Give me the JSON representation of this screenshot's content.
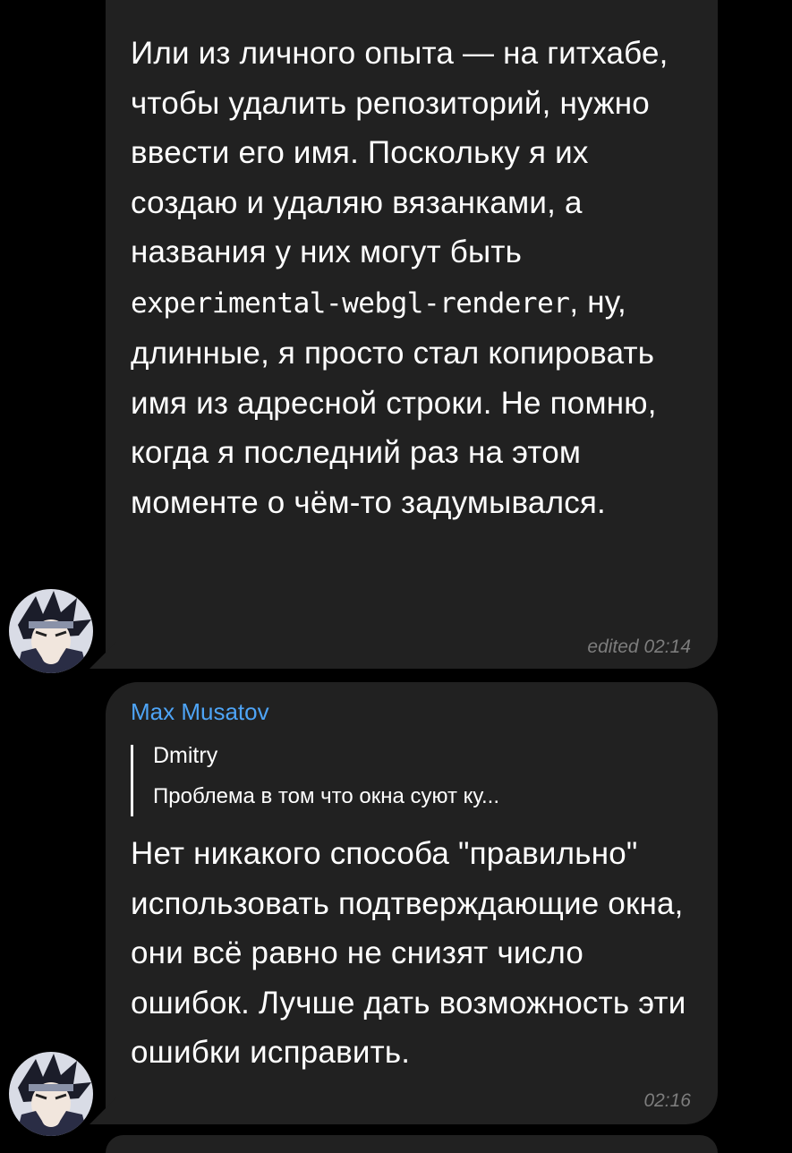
{
  "messages": [
    {
      "text_before": "Или из личного опыта — на гитхабе, чтобы удалить репозиторий, нужно ввести его имя. Поскольку я их создаю и удаляю вязанками, а названия у них могут быть ",
      "code": "experimental-webgl-renderer",
      "text_after": ", ну, длинные, я просто стал копировать имя из адресной строки. Не помню, когда я последний раз на этом моменте о чём-то задумывался.",
      "meta": "edited 02:14",
      "avatar_icon": "user-avatar-icon"
    },
    {
      "sender": "Max Musatov",
      "reply": {
        "name": "Dmitry",
        "text": "Проблема в том что окна суют ку..."
      },
      "text": "Нет никакого способа \"правильно\" использовать подтверждающие окна, они всё равно не снизят число ошибок. Лучше дать возможность эти ошибки исправить.",
      "meta": "02:16",
      "avatar_icon": "user-avatar-icon"
    }
  ],
  "colors": {
    "background": "#000000",
    "bubble": "#212121",
    "sender_name": "#4ea4f6",
    "meta": "#7d7d7d"
  }
}
